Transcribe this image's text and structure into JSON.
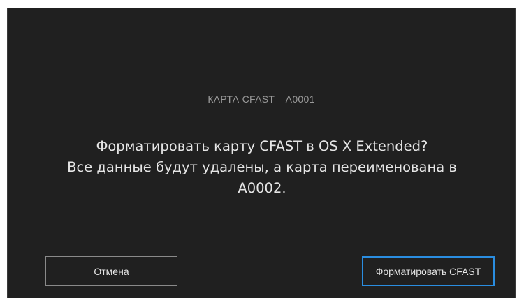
{
  "dialog": {
    "card_title": "КАРТА CFAST – A0001",
    "message_line1": "Форматировать карту CFAST в OS X Extended?",
    "message_line2": "Все данные будут удалены, а карта переименована в",
    "message_line3": "A0002."
  },
  "buttons": {
    "cancel_label": "Отмена",
    "format_label": "Форматировать CFAST"
  },
  "colors": {
    "background": "#202020",
    "text": "#e6e6e6",
    "muted_text": "#9a9a9a",
    "accent": "#2a8de0"
  }
}
